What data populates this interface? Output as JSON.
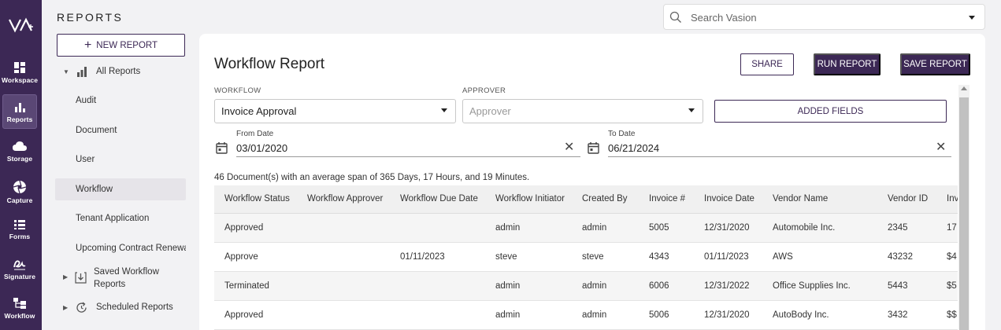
{
  "brand": {
    "logo_text": "VA"
  },
  "rail": {
    "items": [
      {
        "label": "Workspace",
        "icon": "grid-icon"
      },
      {
        "label": "Reports",
        "icon": "bar-chart-icon"
      },
      {
        "label": "Storage",
        "icon": "cloud-icon"
      },
      {
        "label": "Capture",
        "icon": "aperture-icon"
      },
      {
        "label": "Forms",
        "icon": "forms-icon"
      },
      {
        "label": "Signature",
        "icon": "signature-icon"
      },
      {
        "label": "Workflow",
        "icon": "workflow-icon"
      }
    ]
  },
  "reports_panel": {
    "title": "REPORTS",
    "new_report_label": "NEW REPORT",
    "all_reports_label": "All Reports",
    "items": [
      "Audit",
      "Document",
      "User",
      "Workflow",
      "Tenant Application",
      "Upcoming Contract Renewals"
    ],
    "saved_workflow_reports_line1": "Saved Workflow",
    "saved_workflow_reports_line2": "Reports",
    "scheduled_reports": "Scheduled Reports"
  },
  "search": {
    "placeholder": "Search Vasion"
  },
  "report": {
    "title": "Workflow Report",
    "share_label": "SHARE",
    "run_label": "RUN REPORT",
    "save_label": "SAVE REPORT",
    "workflow_label": "WORKFLOW",
    "workflow_value": "Invoice Approval",
    "approver_label": "APPROVER",
    "approver_placeholder": "Approver",
    "added_fields_label": "ADDED FIELDS",
    "from_date_label": "From Date",
    "from_date_value": "03/01/2020",
    "to_date_label": "To Date",
    "to_date_value": "06/21/2024",
    "summary": "46 Document(s) with an average span of 365 Days, 17 Hours, and 19 Minutes."
  },
  "table": {
    "columns": [
      "Workflow Status",
      "Workflow Approver",
      "Workflow Due Date",
      "Workflow Initiator",
      "Created By",
      "Invoice #",
      "Invoice Date",
      "Vendor Name",
      "Vendor ID",
      "Inv"
    ],
    "rows": [
      [
        "Approved",
        "",
        "",
        "admin",
        "admin",
        "5005",
        "12/31/2020",
        "Automobile Inc.",
        "2345",
        "17"
      ],
      [
        "Approve",
        "",
        "01/11/2023",
        "steve",
        "steve",
        "4343",
        "01/11/2023",
        "AWS",
        "43232",
        "$4"
      ],
      [
        "Terminated",
        "",
        "",
        "admin",
        "admin",
        "6006",
        "12/31/2022",
        "Office Supplies Inc.",
        "5443",
        "$5"
      ],
      [
        "Approved",
        "",
        "",
        "admin",
        "admin",
        "5006",
        "12/31/2020",
        "AutoBody Inc.",
        "3432",
        "$$"
      ]
    ]
  },
  "colors": {
    "brand": "#3c2855",
    "rail_active": "#5a4775"
  }
}
